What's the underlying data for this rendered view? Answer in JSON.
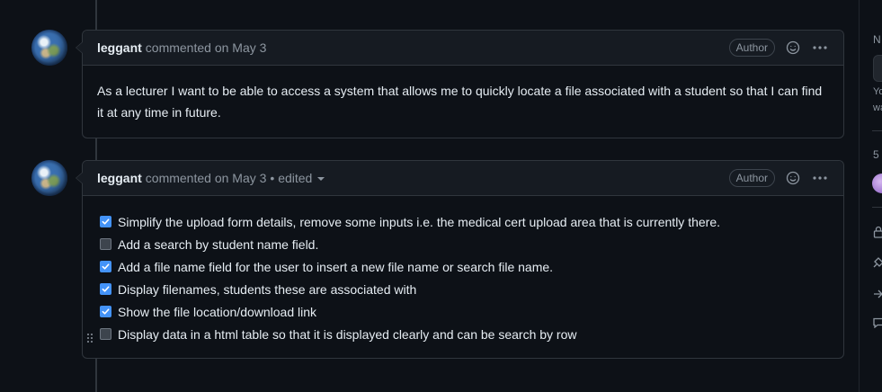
{
  "comments": [
    {
      "author": "leggant",
      "meta": "commented on May 3",
      "badge": "Author",
      "body": "As a lecturer I want to be able to access a system that allows me to quickly locate a file associated with a student so that I can find it at any time in future."
    },
    {
      "author": "leggant",
      "meta": "commented on May 3",
      "edited_label": "• edited",
      "badge": "Author",
      "tasks": [
        {
          "label": "Simplify the upload form details, remove some inputs i.e. the medical cert upload area that is currently there.",
          "checked": true
        },
        {
          "label": "Add a search by student name field.",
          "checked": false
        },
        {
          "label": "Add a file name field for the user to insert a new file name or search file name.",
          "checked": true
        },
        {
          "label": "Display filenames, students these are associated with",
          "checked": true
        },
        {
          "label": "Show the file location/download link",
          "checked": true
        },
        {
          "label": "Display data in a html table so that it is displayed clearly and can be search by row",
          "checked": false
        }
      ]
    }
  ],
  "right_rail": {
    "heading_fragment": "N",
    "text_line1": "Yo",
    "text_line2": "wa",
    "count": "5"
  },
  "colors": {
    "background": "#0d1117",
    "header_bg": "#161b22",
    "border": "#30363d",
    "checkbox_checked": "#4493f8",
    "muted_text": "#8d96a0"
  },
  "icons": {
    "reaction": "smiley-icon",
    "menu": "kebab-horizontal-icon",
    "drag": "grabber-icon"
  }
}
